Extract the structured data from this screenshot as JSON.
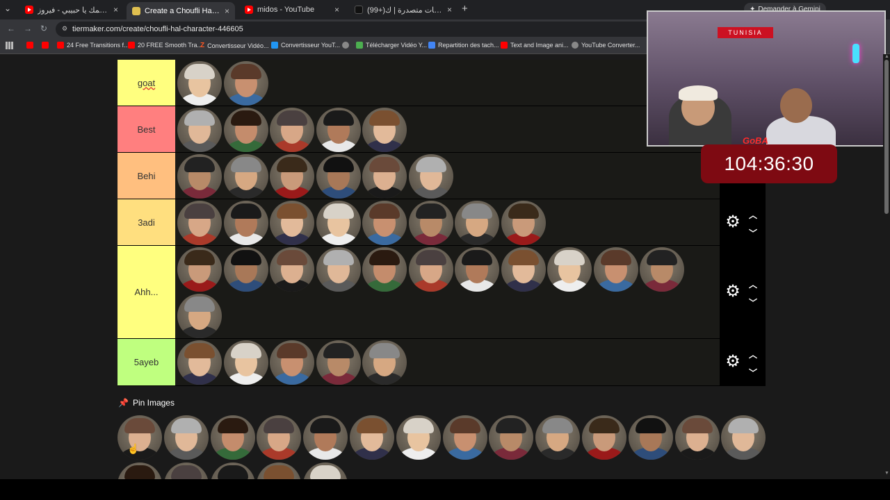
{
  "browser": {
    "tabs": [
      {
        "title": "بكتب اسمك يا حبيبي - فيروز | be",
        "favicon": "youtube-icon",
        "active": false
      },
      {
        "title": "Create a Choufli Hal Character",
        "favicon": "tiermaker-icon",
        "active": true
      },
      {
        "title": "midos - YouTube",
        "favicon": "youtube-icon",
        "active": false
      },
      {
        "title": "(99+)شاهد فيديوهات متصدرة | ك",
        "favicon": "tiktok-icon",
        "active": false
      }
    ],
    "gemini_label": "Demander à Gemini",
    "url": "tiermaker.com/create/choufli-hal-character-446605",
    "bookmarks": [
      {
        "label": "",
        "icon": "youtube-icon"
      },
      {
        "label": "",
        "icon": "youtube-icon"
      },
      {
        "label": "24 Free Transitions f...",
        "icon": "youtube-icon"
      },
      {
        "label": "20 FREE Smooth Tra...",
        "icon": "youtube-icon"
      },
      {
        "label": "Convertisseur Vidéo...",
        "icon": "z-icon"
      },
      {
        "label": "Convertisseur YouT...",
        "icon": "converter-icon"
      },
      {
        "label": "",
        "icon": "globe-icon"
      },
      {
        "label": "Télécharger Vidéo Y...",
        "icon": "download-icon"
      },
      {
        "label": "Repartition des tach...",
        "icon": "doc-icon"
      },
      {
        "label": "Text and Image ani...",
        "icon": "youtube-icon"
      },
      {
        "label": "YouTube Converter...",
        "icon": "globe-icon"
      }
    ]
  },
  "tierlist": {
    "tiers": [
      {
        "label": "goat",
        "color": "#ffff7f",
        "count": 2
      },
      {
        "label": "Best",
        "color": "#ff7f7f",
        "count": 5
      },
      {
        "label": "Behi",
        "color": "#ffbf7f",
        "count": 6
      },
      {
        "label": "3adi",
        "color": "#ffdf7f",
        "count": 8
      },
      {
        "label": "Ahh...",
        "color": "#ffff7f",
        "count": 12
      },
      {
        "label": "5ayeb",
        "color": "#bfff7f",
        "count": 5
      }
    ]
  },
  "pin_images": {
    "heading": "Pin Images",
    "count": 19
  },
  "stream": {
    "timer": "104:36:30",
    "banner": "TUNISIA",
    "logo": "GoBA"
  }
}
